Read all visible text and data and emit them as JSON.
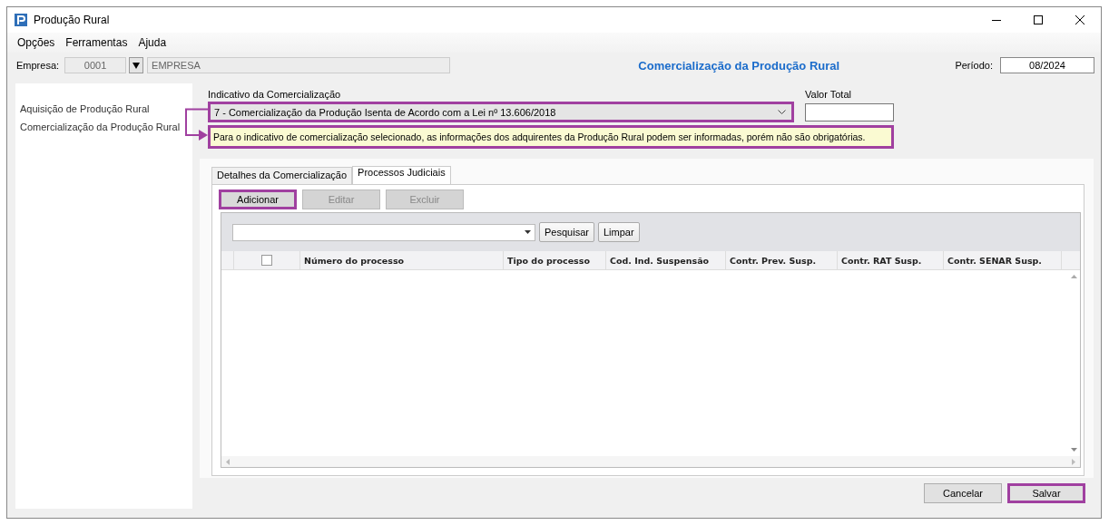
{
  "window": {
    "title": "Produção Rural"
  },
  "menu": [
    {
      "label": "Opções"
    },
    {
      "label": "Ferramentas"
    },
    {
      "label": "Ajuda"
    }
  ],
  "header": {
    "empresa_label": "Empresa:",
    "empresa_code": "0001",
    "empresa_name": "EMPRESA",
    "title": "Comercialização da Produção Rural",
    "periodo_label": "Período:",
    "periodo_value": "08/2024"
  },
  "sidebar": {
    "items": [
      {
        "label": "Aquisição de Produção Rural"
      },
      {
        "label": "Comercialização da Produção Rural"
      }
    ]
  },
  "form": {
    "indicativo_label": "Indicativo da Comercialização",
    "indicativo_value": "7 - Comercialização da Produção Isenta de Acordo com a Lei nº 13.606/2018",
    "indicativo_highlighted": true,
    "valor_label": "Valor Total",
    "note": "Para o indicativo de comercialização selecionado, as informações dos adquirentes da Produção Rural podem ser informadas, porém não são obrigatórias.",
    "note_highlighted": true
  },
  "tabs": [
    {
      "label": "Detalhes da Comercialização",
      "selected": false
    },
    {
      "label": "Processos Judiciais",
      "selected": true
    }
  ],
  "actions": [
    {
      "label": "Adicionar",
      "disabled": false,
      "highlighted": true
    },
    {
      "label": "Editar",
      "disabled": true,
      "highlighted": false
    },
    {
      "label": "Excluir",
      "disabled": true,
      "highlighted": false
    }
  ],
  "search": {
    "buttons": [
      "Pesquisar",
      "Limpar"
    ]
  },
  "table": {
    "select_all_checked": false,
    "columns": [
      "Número do processo",
      "Tipo do processo",
      "Cod. Ind. Suspensão",
      "Contr. Prev. Susp.",
      "Contr. RAT Susp.",
      "Contr. SENAR Susp."
    ]
  },
  "footer": {
    "buttons": [
      {
        "label": "Cancelar",
        "highlighted": false
      },
      {
        "label": "Salvar",
        "highlighted": true
      }
    ]
  }
}
